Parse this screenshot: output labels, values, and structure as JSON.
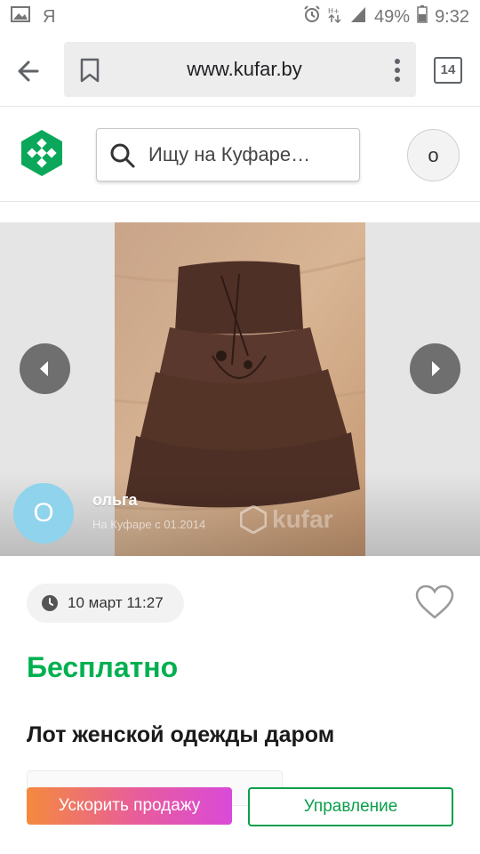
{
  "status_bar": {
    "left_icons": [
      "image-icon",
      "yandex-icon"
    ],
    "yandex_letter": "Я",
    "battery": "49%",
    "time": "9:32"
  },
  "browser": {
    "url": "www.kufar.by",
    "tabs_count": "14"
  },
  "site": {
    "search_placeholder": "Ищу на Куфаре…",
    "user_initial": "о",
    "brand_color": "#00b050"
  },
  "listing": {
    "seller": {
      "initial": "О",
      "name": "ольга",
      "since": "На Куфаре с 01.2014"
    },
    "watermark": "kufar",
    "date": "10 март 11:27",
    "price": "Бесплатно",
    "title": "Лот женской одежды даром"
  },
  "actions": {
    "promote_label": "Ускорить продажу",
    "manage_label": "Управление"
  }
}
